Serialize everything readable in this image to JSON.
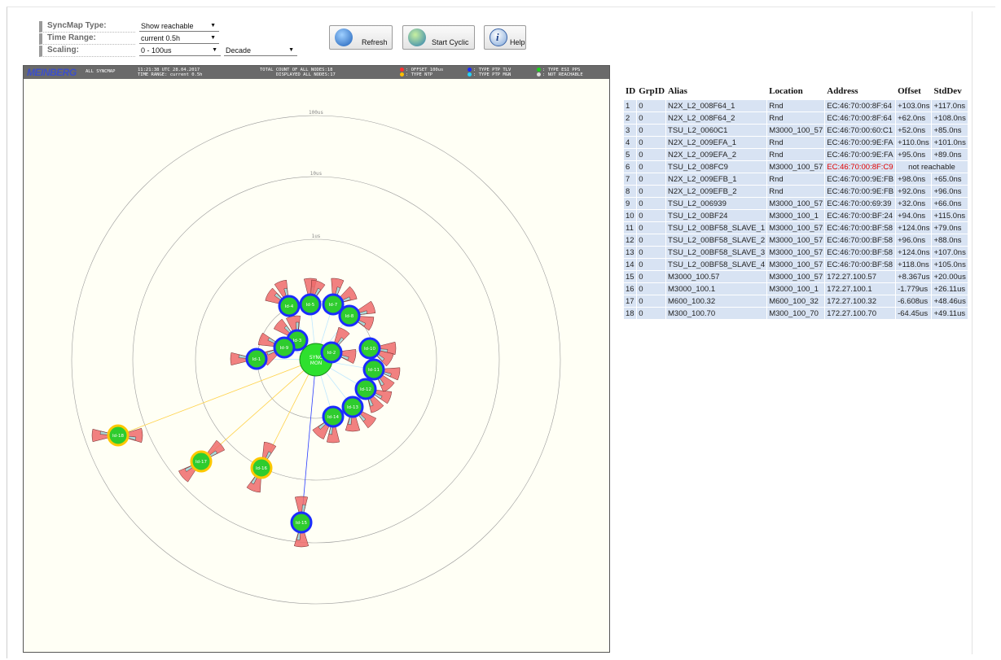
{
  "controls": {
    "syncmap_type": {
      "label": "SyncMap Type:",
      "value": "Show reachable"
    },
    "time_range": {
      "label": "Time Range:",
      "value": "current 0.5h"
    },
    "scaling": {
      "label": "Scaling:",
      "value": "0 - 100us",
      "mode": "Decade"
    }
  },
  "buttons": {
    "refresh": "Refresh",
    "start_cyclic": "Start Cyclic",
    "help": "Help"
  },
  "map_header": {
    "logo": "MEINBERG",
    "mode": "ALL SYNCMAP",
    "time_line": "11:21:38 UTC 28.04.2017",
    "time_range_line": "TIME RANGE: current 0.5h",
    "total_nodes": "TOTAL COUNT OF ALL NODES:18",
    "displayed_nodes": "DISPLAYED ALL NODES:17",
    "legend": [
      {
        "text": ": OFFSET 100us",
        "color": "#ff3030"
      },
      {
        "text": ": TYPE NTP",
        "color": "#ffbf00"
      },
      {
        "text": ": TYPE PTP TLV",
        "color": "#1a2cff"
      },
      {
        "text": ": TYPE PTP MGN",
        "color": "#22d5ff"
      },
      {
        "text": ": TYPE ESI PPS",
        "color": "#19d219"
      },
      {
        "text": ": NOT REACHABLE",
        "color": "#dcdcdc"
      }
    ]
  },
  "map": {
    "rings": [
      "100us",
      "10us",
      "1us"
    ],
    "center_label": [
      "SYNC",
      "MON"
    ],
    "nodes": [
      {
        "id": "Id-1",
        "type": "ptp"
      },
      {
        "id": "Id-2",
        "type": "ptp"
      },
      {
        "id": "Id-3",
        "type": "ptp"
      },
      {
        "id": "Id-4",
        "type": "ptp"
      },
      {
        "id": "Id-5",
        "type": "ptp"
      },
      {
        "id": "Id-7",
        "type": "ptp"
      },
      {
        "id": "Id-8",
        "type": "ptp"
      },
      {
        "id": "Id-9",
        "type": "ptp"
      },
      {
        "id": "Id-10",
        "type": "ptp"
      },
      {
        "id": "Id-11",
        "type": "ptp"
      },
      {
        "id": "Id-12",
        "type": "ptp"
      },
      {
        "id": "Id-13",
        "type": "ptp"
      },
      {
        "id": "Id-14",
        "type": "ptp"
      },
      {
        "id": "Id-15",
        "type": "ptp"
      },
      {
        "id": "Id-16",
        "type": "ntp"
      },
      {
        "id": "Id-17",
        "type": "ntp"
      },
      {
        "id": "Id-18",
        "type": "ntp"
      }
    ]
  },
  "table": {
    "headers": [
      "ID",
      "GrpID",
      "Alias",
      "Location",
      "Address",
      "Offset",
      "StdDev"
    ],
    "rows": [
      [
        "1",
        "0",
        "N2X_L2_008F64_1",
        "Rnd",
        "EC:46:70:00:8F:64",
        "+103.0ns",
        "+117.0ns"
      ],
      [
        "2",
        "0",
        "N2X_L2_008F64_2",
        "Rnd",
        "EC:46:70:00:8F:64",
        "+62.0ns",
        "+108.0ns"
      ],
      [
        "3",
        "0",
        "TSU_L2_0060C1",
        "M3000_100_57",
        "EC:46:70:00:60:C1",
        "+52.0ns",
        "+85.0ns"
      ],
      [
        "4",
        "0",
        "N2X_L2_009EFA_1",
        "Rnd",
        "EC:46:70:00:9E:FA",
        "+110.0ns",
        "+101.0ns"
      ],
      [
        "5",
        "0",
        "N2X_L2_009EFA_2",
        "Rnd",
        "EC:46:70:00:9E:FA",
        "+95.0ns",
        "+89.0ns"
      ],
      [
        "6",
        "0",
        "TSU_L2_008FC9",
        "M3000_100_57",
        "EC:46:70:00:8F:C9",
        "not reachable",
        ""
      ],
      [
        "7",
        "0",
        "N2X_L2_009EFB_1",
        "Rnd",
        "EC:46:70:00:9E:FB",
        "+98.0ns",
        "+65.0ns"
      ],
      [
        "8",
        "0",
        "N2X_L2_009EFB_2",
        "Rnd",
        "EC:46:70:00:9E:FB",
        "+92.0ns",
        "+96.0ns"
      ],
      [
        "9",
        "0",
        "TSU_L2_006939",
        "M3000_100_57",
        "EC:46:70:00:69:39",
        "+32.0ns",
        "+66.0ns"
      ],
      [
        "10",
        "0",
        "TSU_L2_00BF24",
        "M3000_100_1",
        "EC:46:70:00:BF:24",
        "+94.0ns",
        "+115.0ns"
      ],
      [
        "11",
        "0",
        "TSU_L2_00BF58_SLAVE_1",
        "M3000_100_57",
        "EC:46:70:00:BF:58",
        "+124.0ns",
        "+79.0ns"
      ],
      [
        "12",
        "0",
        "TSU_L2_00BF58_SLAVE_2",
        "M3000_100_57",
        "EC:46:70:00:BF:58",
        "+96.0ns",
        "+88.0ns"
      ],
      [
        "13",
        "0",
        "TSU_L2_00BF58_SLAVE_3",
        "M3000_100_57",
        "EC:46:70:00:BF:58",
        "+124.0ns",
        "+107.0ns"
      ],
      [
        "14",
        "0",
        "TSU_L2_00BF58_SLAVE_4",
        "M3000_100_57",
        "EC:46:70:00:BF:58",
        "+118.0ns",
        "+105.0ns"
      ],
      [
        "15",
        "0",
        "M3000_100.57",
        "M3000_100_57",
        "172.27.100.57",
        "+8.367us",
        "+20.00us"
      ],
      [
        "16",
        "0",
        "M3000_100.1",
        "M3000_100_1",
        "172.27.100.1",
        "-1.779us",
        "+26.11us"
      ],
      [
        "17",
        "0",
        "M600_100.32",
        "M600_100_32",
        "172.27.100.32",
        "-6.608us",
        "+48.46us"
      ],
      [
        "18",
        "0",
        "M300_100.70",
        "M300_100_70",
        "172.27.100.70",
        "-64.45us",
        "+49.11us"
      ]
    ]
  }
}
